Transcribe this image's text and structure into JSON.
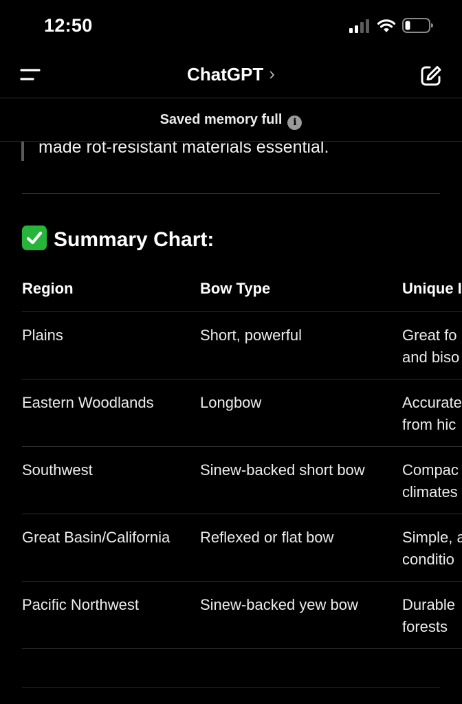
{
  "status_bar": {
    "time": "12:50"
  },
  "header": {
    "title": "ChatGPT",
    "chevron": "›"
  },
  "banner": {
    "text": "Saved memory full",
    "info_glyph": "i"
  },
  "content": {
    "quote_line": "made rot-resistant materials essential.",
    "heading": "Summary Chart:",
    "table": {
      "headers": [
        "Region",
        "Bow Type",
        "Unique I"
      ],
      "rows": [
        [
          "Plains",
          "Short, powerful",
          "Great fo\nand biso"
        ],
        [
          "Eastern Woodlands",
          "Longbow",
          "Accurate\nfrom hic"
        ],
        [
          "Southwest",
          "Sinew-backed short bow",
          "Compac\nclimates"
        ],
        [
          "Great Basin/California",
          "Reflexed or flat bow",
          "Simple, a\nconditio"
        ],
        [
          "Pacific Northwest",
          "Sinew-backed yew bow",
          "Durable\nforests"
        ]
      ]
    }
  },
  "colors": {
    "background": "#000000",
    "text": "#ffffff",
    "divider": "#2c2c2c",
    "check_green": "#27b43a"
  }
}
